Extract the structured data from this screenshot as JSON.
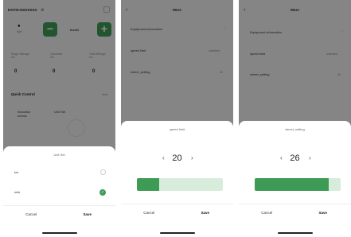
{
  "screen1": {
    "device_id": "KOTIS-NXXXXXX",
    "light_label": "light",
    "level_label": "level1",
    "stats": [
      {
        "label": "Single Mileage",
        "unit": "km",
        "value": "0"
      },
      {
        "label": "Odometer",
        "unit": "km",
        "value": "0"
      },
      {
        "label": "Total Mileage",
        "unit": "km",
        "value": "0"
      }
    ],
    "quick_control_title": "Quick Control",
    "quick_control_more": "more",
    "quick_items": [
      "Induction unlock",
      "Unit Set"
    ],
    "sheet": {
      "title": "Unit Set",
      "options": [
        {
          "label": "km",
          "selected": false
        },
        {
          "label": "mile",
          "selected": true
        }
      ],
      "cancel": "Cancel",
      "save": "Save"
    }
  },
  "screen2": {
    "title": "More",
    "rows": [
      {
        "label": "Equipment information",
        "value": ""
      },
      {
        "label": "speed limit",
        "value": "unlimited"
      },
      {
        "label": "wheel_setting",
        "value": "20"
      }
    ],
    "sheet": {
      "title": "speed limit",
      "value": "20",
      "minus": "‹",
      "plus": "›",
      "fill_fraction": 0.26,
      "cancel": "Cancel",
      "save": "Save"
    }
  },
  "screen3": {
    "title": "More",
    "rows": [
      {
        "label": "Equipment information",
        "value": ""
      },
      {
        "label": "speed limit",
        "value": "unlimited"
      },
      {
        "label": "wheel_setting",
        "value": "26"
      }
    ],
    "sheet": {
      "title": "wheel_setting",
      "value": "26",
      "minus": "‹",
      "plus": "›",
      "fill_fraction": 0.86,
      "cancel": "Cancel",
      "save": "Save"
    }
  },
  "colors": {
    "accent": "#3e9b56",
    "track": "#d8ecdc"
  }
}
